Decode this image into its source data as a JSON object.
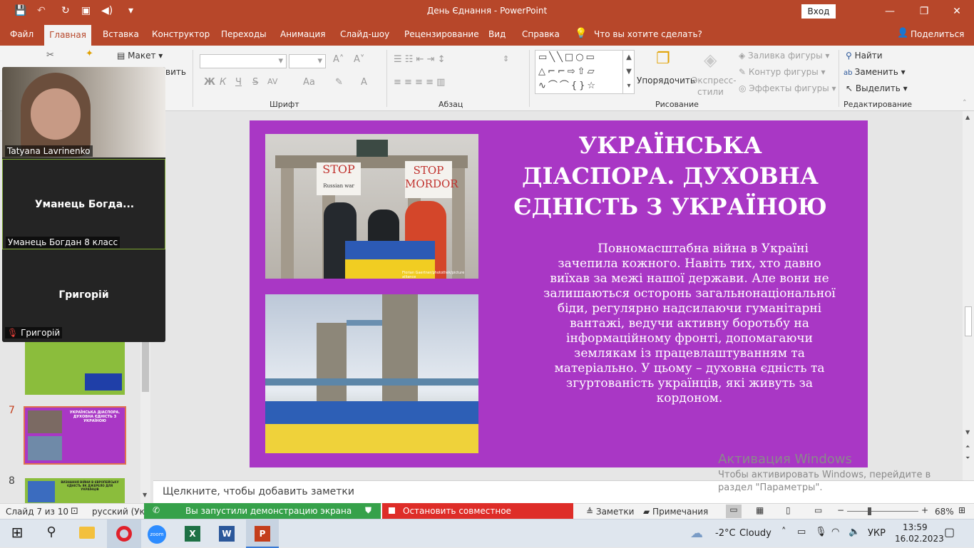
{
  "window": {
    "title": "День Єднання  -  PowerPoint",
    "login_label": "Вход",
    "minimize": "—",
    "restore": "❐",
    "close": "✕"
  },
  "quick_access": {
    "save": "💾",
    "undo": "↶",
    "redo": "↻",
    "present": "▣",
    "audio": "◀)",
    "more": "▾"
  },
  "tabs": [
    {
      "label": "Файл"
    },
    {
      "label": "Главная"
    },
    {
      "label": "Вставка"
    },
    {
      "label": "Конструктор"
    },
    {
      "label": "Переходы"
    },
    {
      "label": "Анимация"
    },
    {
      "label": "Слайд-шоу"
    },
    {
      "label": "Рецензирование"
    },
    {
      "label": "Вид"
    },
    {
      "label": "Справка"
    }
  ],
  "tell_me": {
    "icon": "lightbulb-icon",
    "label": "Что вы хотите сделать?"
  },
  "share": {
    "icon": "person-icon",
    "label": "Поделиться"
  },
  "ribbon": {
    "slides": {
      "layout": "Макет",
      "reset_partial": "вить"
    },
    "font": {
      "group": "Шрифт",
      "bold": "Ж",
      "italic": "К",
      "underline": "Ч",
      "strike": "S",
      "spacing": "AV",
      "case": "Aa",
      "color": "A"
    },
    "paragraph": {
      "group": "Абзац"
    },
    "drawing": {
      "group": "Рисование",
      "arrange": "Упорядочить",
      "styles_line1": "Экспресс-",
      "styles_line2": "стили",
      "fill": "Заливка фигуры",
      "outline": "Контур фигуры",
      "effects": "Эффекты фигуры"
    },
    "editing": {
      "group": "Редактирование",
      "find": "Найти",
      "replace": "Заменить",
      "select": "Выделить"
    }
  },
  "thumbnails": [
    {
      "num": "7",
      "title": "УКРАЇНСЬКА ДІАСПОРА. ДУХОВНА ЄДНІСТЬ З УКРАЇНОЮ"
    },
    {
      "num": "8",
      "title": "ВИЗНАННЯ ВІЙНИ В ЄВРОПЕЙСЬКУ ЄДНІСТЬ ЯК ДЖЕРЕЛО ДЛЯ УКРАЇНЦІВ"
    }
  ],
  "slide": {
    "title": "УКРАЇНСЬКА ДІАСПОРА. ДУХОВНА ЄДНІСТЬ З УКРАЇНОЮ",
    "body": "Повномасштабна війна в Україні зачепила кожного. Навіть тих, хто давно виїхав за межі нашої держави. Але вони не залишаються осторонь загальнонаціональної біди, регулярно надсилаючи гуманітарні вантажі, ведучи активну боротьбу на інформаційному фронті, допомагаючи землякам із працевлаштуванням та  матеріально. У цьому – духовна єдність та згуртованість українців, які живуть за кордоном.",
    "sign1": "STOP",
    "sign1_sub": "Russian war",
    "sign2": "STOP MORDOR",
    "photo_credit": "Florian Gaertner/photothek/picture alliance"
  },
  "notes_placeholder": "Щелкните, чтобы добавить заметки",
  "activation": {
    "title": "Активация Windows",
    "line1": "Чтобы активировать Windows, перейдите в",
    "line2": "раздел \"Параметры\"."
  },
  "status": {
    "slide_of": "Слайд 7 из 10",
    "language": "русский (Укра",
    "notes": "Заметки",
    "comments": "Примечания",
    "zoom": "68%",
    "zoom_minus": "−",
    "zoom_plus": "+"
  },
  "zoom_share": {
    "started": "Вы запустили демонстрацию экрана",
    "stop": "Остановить совместное использование"
  },
  "participants": [
    {
      "name": "Tatyana Lavrinenko"
    },
    {
      "name": "Уманець Богдан 8 класс",
      "short": "Уманець  Богда..."
    },
    {
      "name": "Григорій",
      "short": "Григорій"
    }
  ],
  "taskbar": {
    "weather_temp": "-2°C",
    "weather_text": "Cloudy",
    "lang": "УКР",
    "time": "13:59",
    "date": "16.02.2023",
    "zoom_app": "zoom"
  },
  "colors": {
    "accent": "#b7472a",
    "slide_bg": "#a937c5",
    "share_green": "#36a14a",
    "share_red": "#de2d28"
  }
}
